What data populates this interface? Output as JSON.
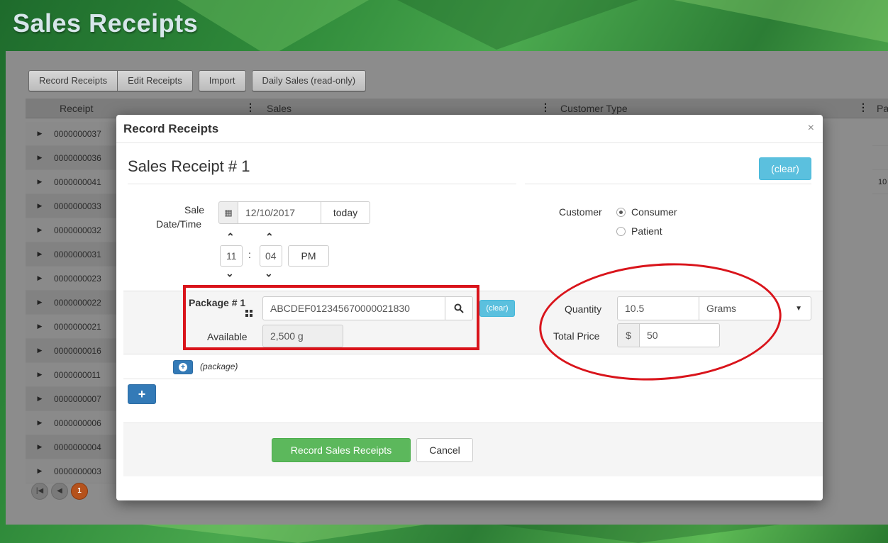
{
  "page": {
    "title": "Sales Receipts"
  },
  "toolbar": {
    "record_receipts": "Record Receipts",
    "edit_receipts": "Edit Receipts",
    "import": "Import",
    "daily_sales": "Daily Sales (read-only)"
  },
  "grid": {
    "columns": [
      "Receipt",
      "Sales",
      "Customer Type",
      "Pa"
    ],
    "rows": [
      "0000000037",
      "0000000036",
      "0000000041",
      "0000000033",
      "0000000032",
      "0000000031",
      "0000000023",
      "0000000022",
      "0000000021",
      "0000000016",
      "0000000011",
      "0000000007",
      "0000000006",
      "0000000004",
      "0000000003"
    ],
    "partial_value_row3": "10",
    "pager_current": "1"
  },
  "modal": {
    "title": "Record Receipts",
    "close": "×",
    "receipt_title": "Sales Receipt # 1",
    "clear_label": "(clear)",
    "sale_label_line1": "Sale",
    "sale_label_line2": "Date/Time",
    "date_value": "12/10/2017",
    "today_label": "today",
    "hour": "11",
    "minute": "04",
    "time_sep": ":",
    "meridiem": "PM",
    "customer_label": "Customer",
    "customer_options": [
      "Consumer",
      "Patient"
    ],
    "customer_selected": "Consumer",
    "package_label": "Package # 1",
    "package_value": "ABCDEF012345670000021830",
    "package_clear": "(clear)",
    "available_label": "Available",
    "available_value": "2,500 g",
    "add_package_label": "(package)",
    "quantity_label": "Quantity",
    "quantity_value": "10.5",
    "unit_value": "Grams",
    "total_price_label": "Total Price",
    "currency_symbol": "$",
    "total_price_value": "50",
    "record_button": "Record Sales Receipts",
    "cancel_button": "Cancel"
  },
  "colors": {
    "accent_info": "#5bc0de",
    "success": "#5cb85c",
    "annotation_red": "#d9141b",
    "pager_active": "#b5521c"
  }
}
